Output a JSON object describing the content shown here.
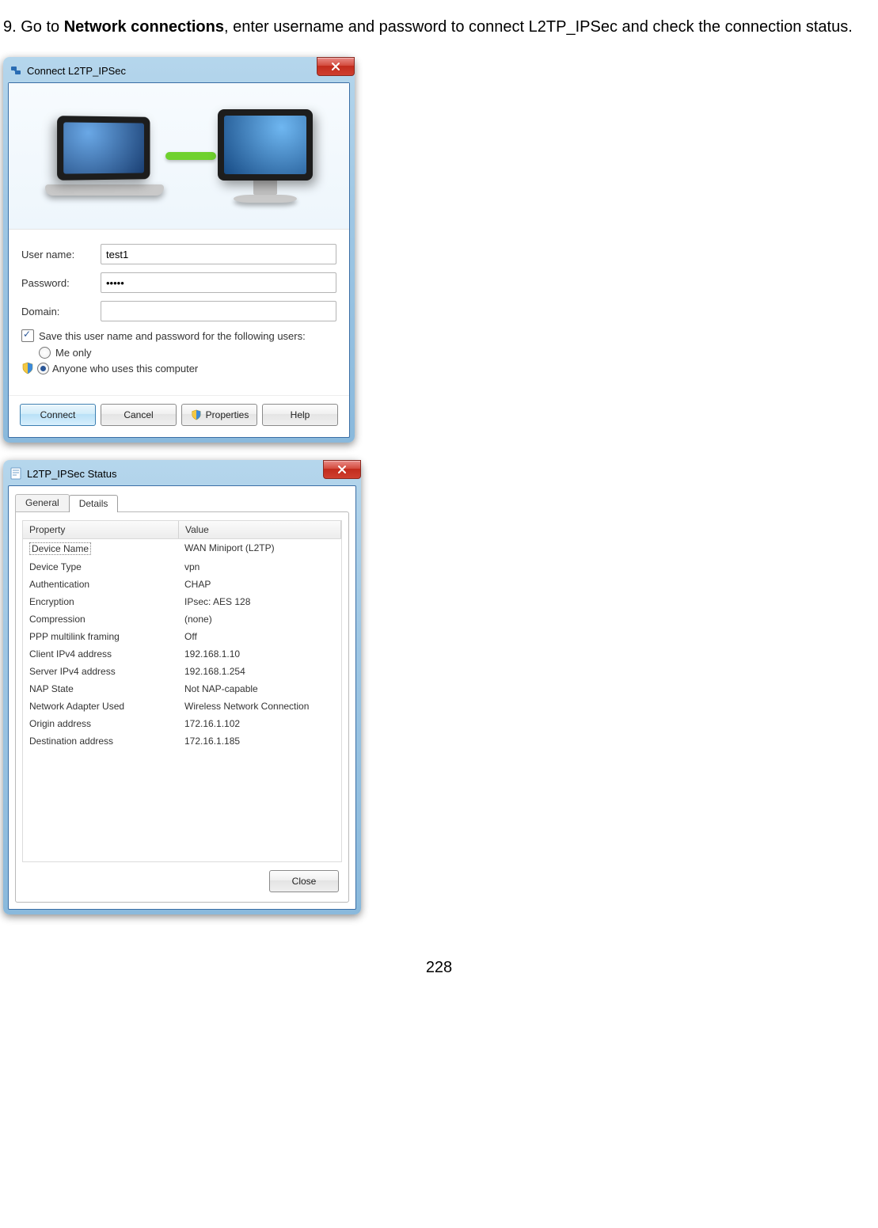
{
  "instruction": {
    "prefix": "9. Go to ",
    "bold": "Network connections",
    "suffix": ", enter username and password to connect L2TP_IPSec and check the connection status."
  },
  "connectDialog": {
    "title": "Connect L2TP_IPSec",
    "labels": {
      "user": "User name:",
      "pass": "Password:",
      "domain": "Domain:"
    },
    "fields": {
      "user": "test1",
      "passMasked": "•••••",
      "domain": ""
    },
    "saveCheckbox": "Save this user name and password for the following users:",
    "saveChecked": true,
    "radios": {
      "meOnly": {
        "label": "Me only",
        "checked": false
      },
      "anyone": {
        "label": "Anyone who uses this computer",
        "checked": true
      }
    },
    "buttons": {
      "connect": "Connect",
      "cancel": "Cancel",
      "properties": "Properties",
      "help": "Help"
    }
  },
  "statusDialog": {
    "title": "L2TP_IPSec Status",
    "tabs": {
      "general": "General",
      "details": "Details"
    },
    "headers": {
      "property": "Property",
      "value": "Value"
    },
    "rows": [
      {
        "prop": "Device Name",
        "val": "WAN Miniport (L2TP)"
      },
      {
        "prop": "Device Type",
        "val": "vpn"
      },
      {
        "prop": "Authentication",
        "val": "CHAP"
      },
      {
        "prop": "Encryption",
        "val": "IPsec: AES 128"
      },
      {
        "prop": "Compression",
        "val": "(none)"
      },
      {
        "prop": "PPP multilink framing",
        "val": "Off"
      },
      {
        "prop": "Client IPv4 address",
        "val": "192.168.1.10"
      },
      {
        "prop": "Server IPv4 address",
        "val": "192.168.1.254"
      },
      {
        "prop": "NAP State",
        "val": "Not NAP-capable"
      },
      {
        "prop": "Network Adapter Used",
        "val": "Wireless Network Connection"
      },
      {
        "prop": "Origin address",
        "val": "172.16.1.102"
      },
      {
        "prop": "Destination address",
        "val": "172.16.1.185"
      }
    ],
    "closeButton": "Close"
  },
  "pageNumber": "228"
}
